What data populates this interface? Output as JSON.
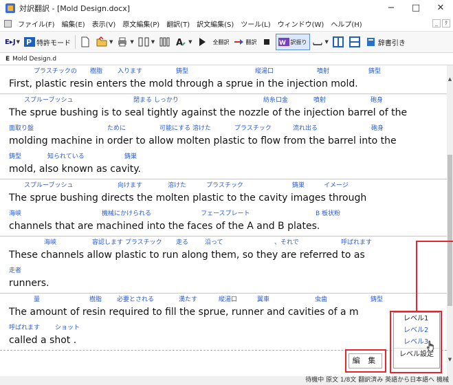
{
  "window": {
    "title": "対訳翻訳 - [Mold Design.docx]",
    "controls": [
      "−",
      "□",
      "✕"
    ]
  },
  "menu": {
    "items": [
      "ファイル(F)",
      "編集(E)",
      "表示(V)",
      "原文編集(P)",
      "翻訳(T)",
      "訳文編集(S)",
      "ツール(L)",
      "ウィンドウ(W)",
      "ヘルプ(H)"
    ],
    "mdi": [
      "_",
      "ｸ"
    ]
  },
  "toolbar": {
    "mode_label": "特許モード",
    "translate_all": "全翻訳",
    "translate": "翻訳",
    "translation_mode": "訳振り",
    "dictionary_lookup": "辞書引き"
  },
  "doc_tab": {
    "prefix": "E",
    "name": "Mold Design.d"
  },
  "paragraphs": [
    {
      "lines": [
        {
          "gloss": [
            "プラスチックの",
            "樹脂",
            "入ります",
            "鋳型",
            "縦湯口",
            "噴射",
            "鋳型"
          ],
          "text": "First, plastic    resin enters the mold through a sprue in the injection mold."
        }
      ]
    },
    {
      "lines": [
        {
          "gloss": [
            "スプルーブッシュ",
            "閉まる しっかり",
            "紡糸口金",
            "噴射",
            "砲身"
          ],
          "text": "The sprue bushing is to seal tightly against the nozzle of the injection barrel of the"
        },
        {
          "gloss": [
            "面取り盤",
            "ために",
            "可能にする 溶けた",
            "プラスチック",
            "流れ出る",
            "砲身"
          ],
          "text": "molding machine in order to allow   molten plastic   to flow   from the barrel into the"
        },
        {
          "gloss": [
            "鋳型",
            "知られている",
            "鋳巣"
          ],
          "text": "mold, also known   as cavity."
        }
      ]
    },
    {
      "lines": [
        {
          "gloss": [
            "スプルーブッシュ",
            "向けます",
            "溶けた",
            "プラスチック",
            "鋳巣",
            "イメージ"
          ],
          "text": "The sprue bushing directs the molten plastic   to the cavity images through"
        },
        {
          "gloss": [
            "海峡",
            "機械にかけられる",
            "フェースプレート",
            "B  板状粉"
          ],
          "text": "channels that are machined  into the faces        of the A and B plates."
        }
      ]
    },
    {
      "lines": [
        {
          "gloss": [
            "海峡",
            "容認します プラスチック",
            "走る",
            "沿って",
            "、それで",
            "呼ばれます"
          ],
          "text": "These channels allow    plastic   to run along them, so   they are referred to as"
        },
        {
          "gloss": [
            "走者"
          ],
          "text": "runners."
        }
      ]
    },
    {
      "lines": [
        {
          "gloss": [
            "量",
            "樹脂",
            "必要とされる",
            "満たす",
            "縦湯口",
            "翼車",
            "虫歯",
            "鋳型"
          ],
          "text": "The amount of resin required to fill   the sprue, runner and cavities of a m"
        },
        {
          "gloss": [
            "呼ばれます",
            "ショット"
          ],
          "text": "called  a shot ."
        }
      ]
    }
  ],
  "popup": {
    "items": [
      "レベル1",
      "レベル2",
      "レベル3"
    ],
    "active": [
      1,
      2
    ],
    "settings": "レベル設定"
  },
  "edit_button": "編 集",
  "status": "待機中  原文  1/8文  翻訳済み  英語から日本語へ  機械",
  "colors": {
    "gloss": "#2a5bd7",
    "highlight": "#e8252f",
    "body_text": "#111111"
  }
}
